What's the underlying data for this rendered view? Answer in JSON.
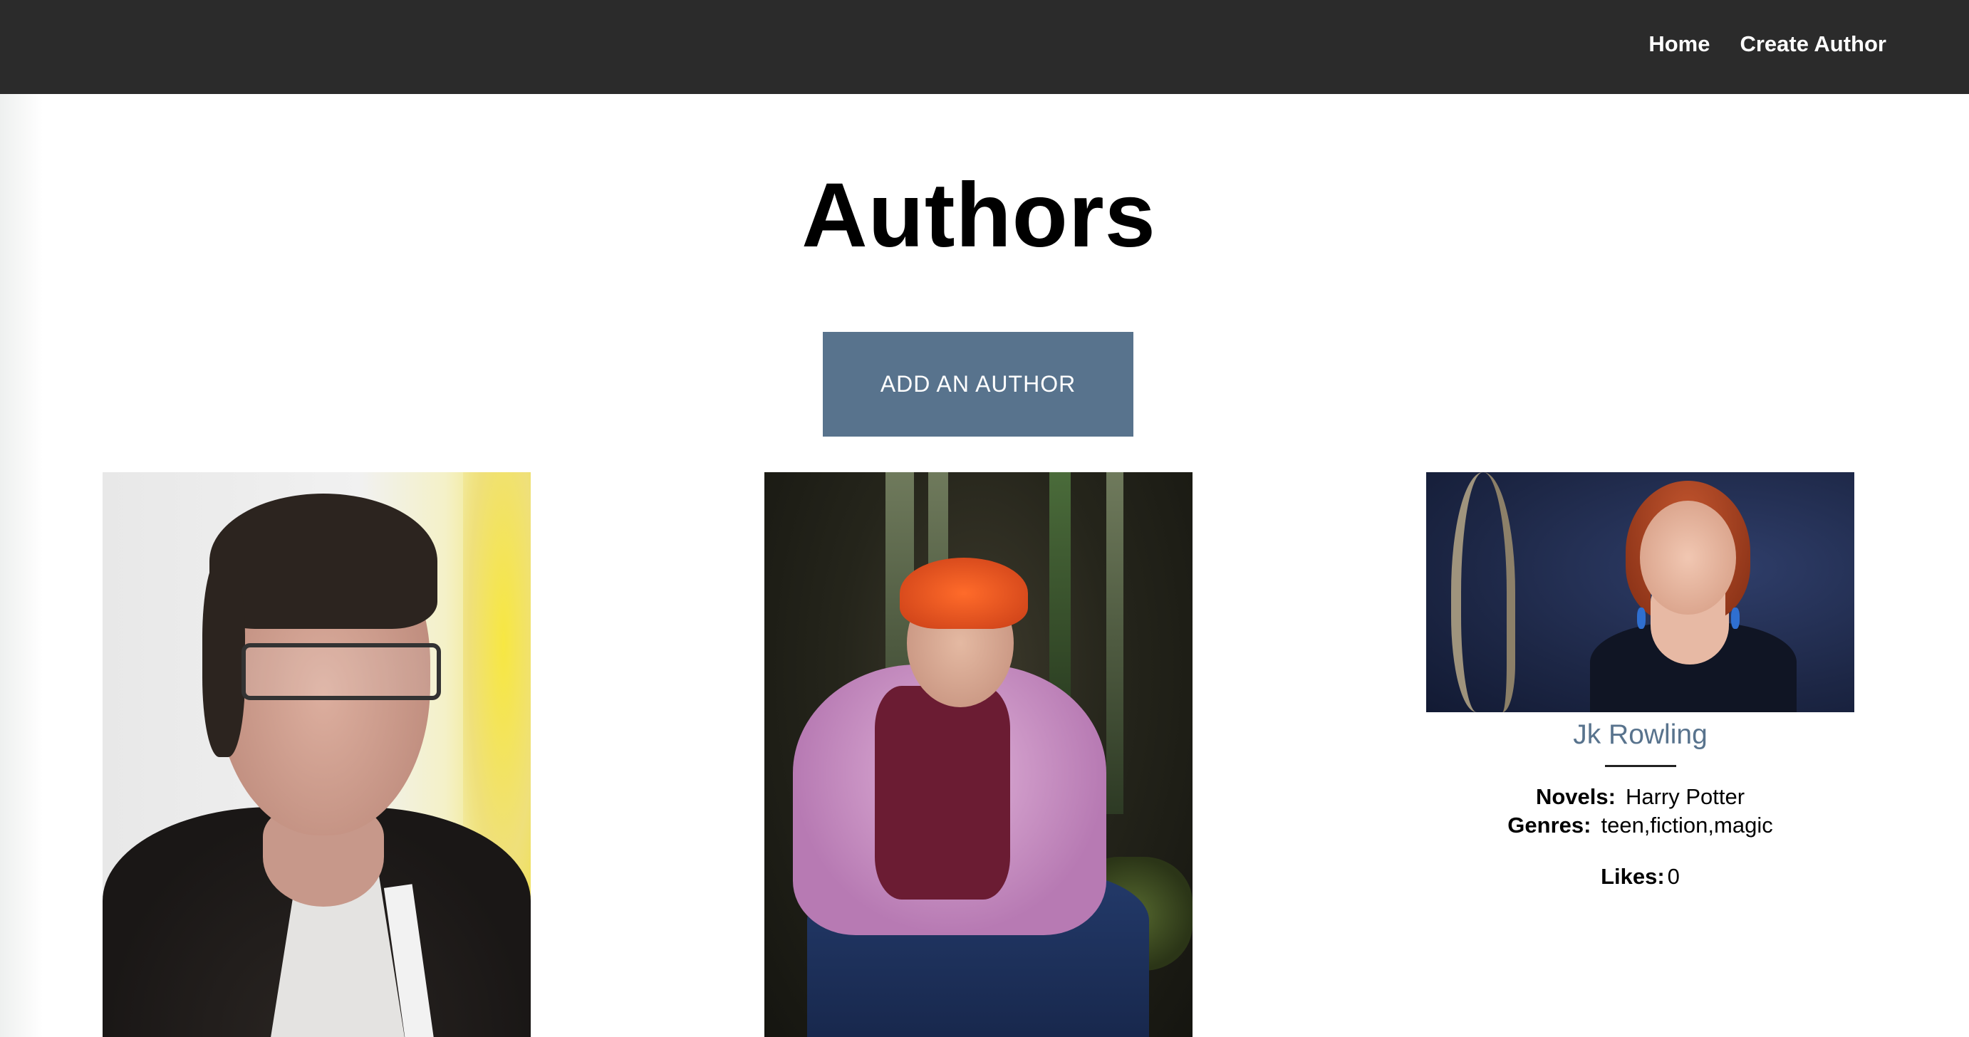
{
  "nav": {
    "links": [
      {
        "label": "Home"
      },
      {
        "label": "Create Author"
      }
    ]
  },
  "page": {
    "title": "Authors",
    "add_button_label": "ADD AN AUTHOR"
  },
  "authors": [
    {
      "image_icon": "author-photo-man-glasses"
    },
    {
      "image_icon": "author-photo-woman-forest"
    },
    {
      "image_icon": "author-photo-jk-rowling",
      "name": "Jk Rowling",
      "novels_label": "Novels:",
      "novels": "Harry Potter",
      "genres_label": "Genres:",
      "genres": "teen,fiction,magic",
      "likes_label": "Likes:",
      "likes": "0"
    }
  ],
  "colors": {
    "navbar": "#2b2b2b",
    "accent": "#58738d",
    "text": "#000000"
  }
}
